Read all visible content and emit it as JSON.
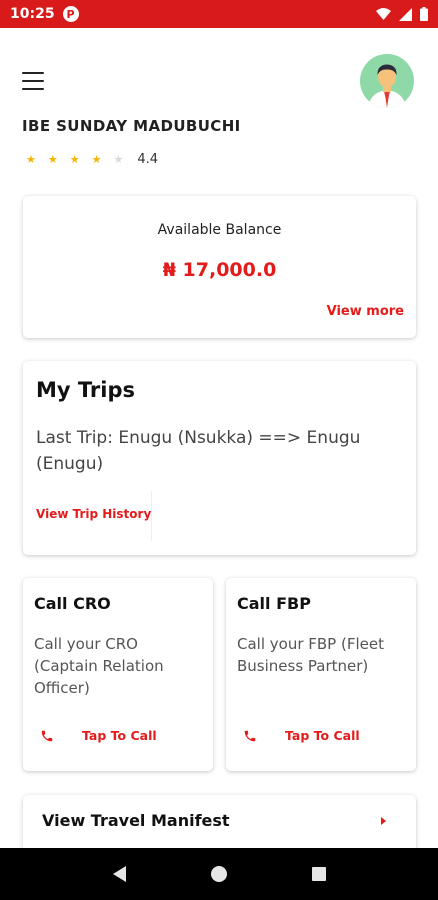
{
  "status_bar": {
    "time": "10:25",
    "app_icon": "circle-p-icon",
    "color": "#d81a1a",
    "icons": [
      "wifi-icon",
      "signal-icon",
      "battery-icon"
    ]
  },
  "header": {
    "menu_icon": "hamburger-menu-icon",
    "avatar_icon": "user-avatar-icon",
    "driver_name": "IBE SUNDAY MADUBUCHI",
    "rating": {
      "value_text": "4.4",
      "filled_stars": 4,
      "total_stars": 5,
      "star_color": "#f5b400"
    }
  },
  "balance_card": {
    "label": "Available Balance",
    "amount": "₦ 17,000.0",
    "view_more": "View more"
  },
  "trips_card": {
    "title": "My Trips",
    "last_trip": "Last Trip: Enugu (Nsukka) ==> Enugu (Enugu)",
    "history_link": "View Trip History"
  },
  "call_cards": [
    {
      "title": "Call CRO",
      "description": "Call your CRO (Captain Relation Officer)",
      "action": "Tap To Call"
    },
    {
      "title": "Call FBP",
      "description": "Call your FBP (Fleet Business Partner)",
      "action": "Tap To Call"
    }
  ],
  "manifest": {
    "label": "View Travel Manifest"
  },
  "theme": {
    "accent": "#e31b1b",
    "avatar_bg": "#8fd9a8"
  },
  "nav_bar": {
    "icons": [
      "back-icon",
      "home-icon",
      "recents-icon"
    ]
  }
}
